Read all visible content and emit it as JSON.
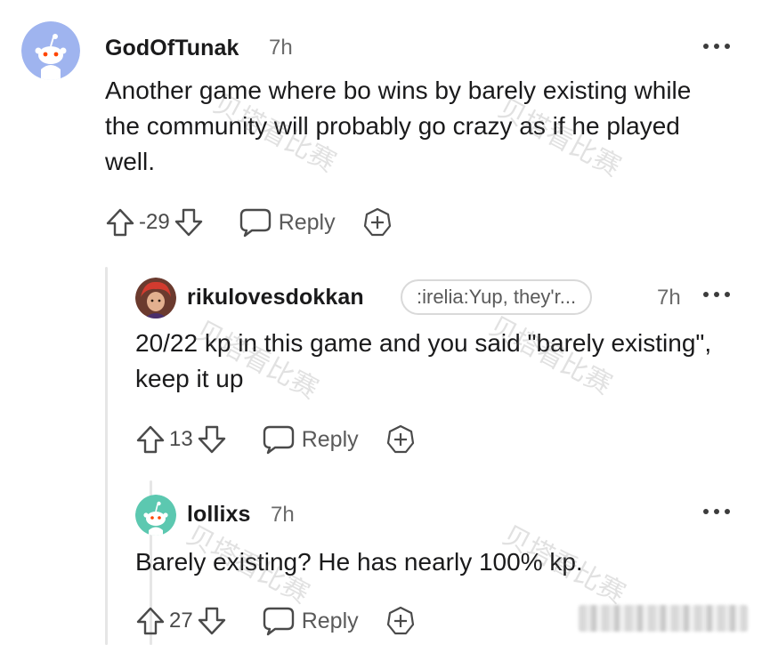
{
  "comments": [
    {
      "username": "GodOfTunak",
      "time": "7h",
      "body": "Another game where bo wins by barely existing while the community will probably go crazy as if he played well.",
      "score": "-29",
      "reply_label": "Reply",
      "avatar": "snoo-avatar-blue"
    },
    {
      "username": "rikulovesdokkan",
      "flair": ":irelia:Yup, they'r...",
      "time": "7h",
      "body": "20/22 kp in this game and you said \"barely existing\", keep it up",
      "score": "13",
      "reply_label": "Reply",
      "avatar": "character-avatar-red"
    },
    {
      "username": "lollixs",
      "time": "7h",
      "body": "Barely existing? He has nearly 100% kp.",
      "score": "27",
      "reply_label": "Reply",
      "avatar": "snoo-avatar-teal"
    }
  ],
  "watermark_text": "贝塔看比赛",
  "colors": {
    "text": "#1a1a1b",
    "meta": "#6a6a6a",
    "thread_line": "#e6e6e6",
    "avatar_blue": "#9fb4ef",
    "avatar_teal": "#5cc8b0"
  }
}
